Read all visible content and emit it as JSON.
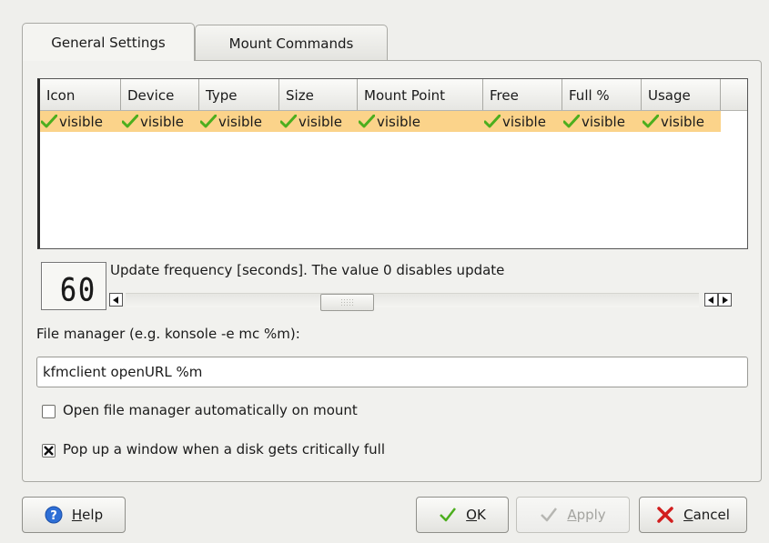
{
  "tabs": [
    {
      "label": "General Settings",
      "active": true
    },
    {
      "label": "Mount Commands",
      "active": false
    }
  ],
  "columns": {
    "headers": [
      "Icon",
      "Device",
      "Type",
      "Size",
      "Mount Point",
      "Free",
      "Full %",
      "Usage"
    ],
    "visibility": [
      "visible",
      "visible",
      "visible",
      "visible",
      "visible",
      "visible",
      "visible",
      "visible"
    ]
  },
  "update": {
    "value": "60",
    "label": "Update frequency [seconds]. The value 0 disables update"
  },
  "file_manager": {
    "label": "File manager (e.g. konsole -e mc %m):",
    "value": "kfmclient openURL %m"
  },
  "options": {
    "open_on_mount": {
      "label": "Open file manager automatically on mount",
      "checked": false
    },
    "popup_full": {
      "label": "Pop up a window when a disk gets critically full",
      "checked": true
    }
  },
  "buttons": {
    "help": {
      "underline": "H",
      "rest": "elp"
    },
    "ok": {
      "underline": "O",
      "rest": "K"
    },
    "apply": {
      "underline": "A",
      "rest": "pply"
    },
    "cancel": {
      "underline": "C",
      "rest": "ancel"
    }
  },
  "colors": {
    "selected_row": "#fbd38a",
    "check_green": "#4cae1e",
    "cancel_red": "#d21e1e",
    "help_blue": "#2e6fd6"
  }
}
